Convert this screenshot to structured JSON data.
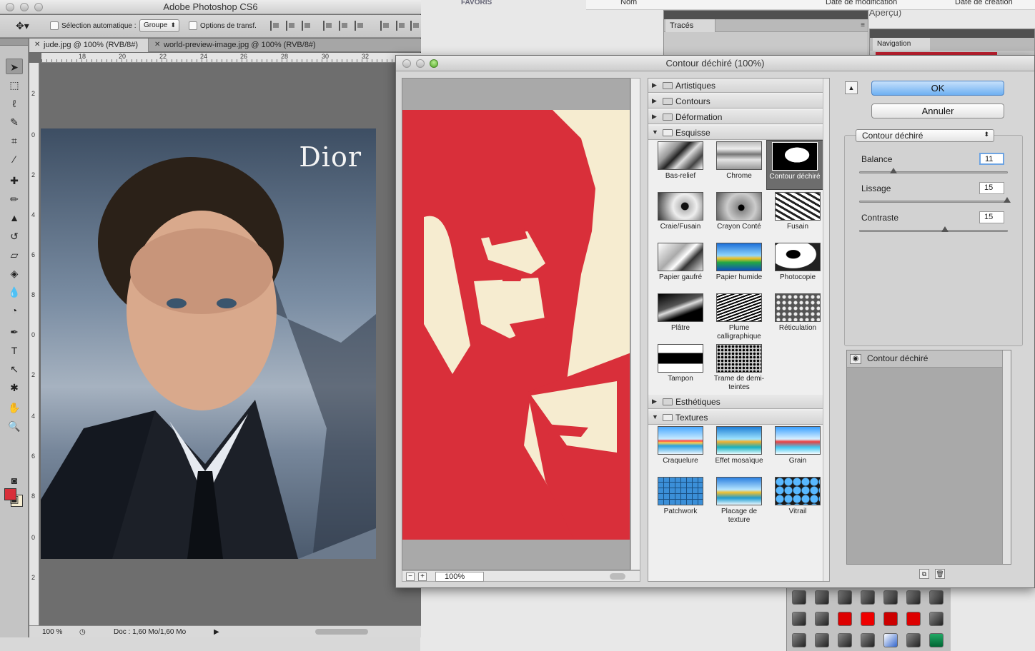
{
  "app": {
    "title": "Adobe Photoshop CS6"
  },
  "background": {
    "cmjn_text": "CMJN/Aperçu)",
    "favoris": "FAVORIS",
    "columns": [
      "Nom",
      "Date de modification",
      "Date de création"
    ],
    "traces_tab": "Tracés",
    "navigation_tab": "Navigation"
  },
  "options_bar": {
    "auto_select_label": "Sélection automatique :",
    "auto_select_value": "Groupe",
    "transform_label": "Options de transf."
  },
  "document_tabs": [
    {
      "label": "jude.jpg @ 100% (RVB/8#)",
      "active": true
    },
    {
      "label": "world-preview-image.jpg @ 100% (RVB/8#)",
      "active": false
    }
  ],
  "ruler_top": [
    "18",
    "20",
    "22",
    "24",
    "26",
    "28",
    "30",
    "32"
  ],
  "ruler_left": [
    "2",
    "0",
    "2",
    "4",
    "6",
    "8",
    "0",
    "2",
    "4",
    "6",
    "8",
    "0",
    "2"
  ],
  "photo": {
    "brand_text": "Dior"
  },
  "status_bar": {
    "zoom": "100 %",
    "doc_info": "Doc : 1,60 Mo/1,60 Mo"
  },
  "colors": {
    "foreground": "#d92f3a",
    "background": "#f5ecd0",
    "ok_blue": "#6eb0f2"
  },
  "dialog": {
    "title": "Contour déchiré (100%)",
    "zoom_value": "100%",
    "categories": [
      {
        "label": "Artistiques",
        "open": false
      },
      {
        "label": "Contours",
        "open": false
      },
      {
        "label": "Déformation",
        "open": false
      },
      {
        "label": "Esquisse",
        "open": true
      },
      {
        "label": "Esthétiques",
        "open": false
      },
      {
        "label": "Textures",
        "open": true
      }
    ],
    "esquisse_filters": [
      {
        "label": "Bas-relief",
        "icon": "bas-relief-thumb"
      },
      {
        "label": "Chrome",
        "icon": "chrome-thumb"
      },
      {
        "label": "Contour déchiré",
        "icon": "contour-dechire-thumb",
        "selected": true
      },
      {
        "label": "Craie/Fusain",
        "icon": "craie-fusain-thumb"
      },
      {
        "label": "Crayon Conté",
        "icon": "crayon-conte-thumb"
      },
      {
        "label": "Fusain",
        "icon": "fusain-thumb"
      },
      {
        "label": "Papier gaufré",
        "icon": "papier-gaufre-thumb"
      },
      {
        "label": "Papier humide",
        "icon": "papier-humide-thumb"
      },
      {
        "label": "Photocopie",
        "icon": "photocopie-thumb"
      },
      {
        "label": "Plâtre",
        "icon": "platre-thumb"
      },
      {
        "label": "Plume calligraphique",
        "icon": "plume-thumb"
      },
      {
        "label": "Réticulation",
        "icon": "reticulation-thumb"
      },
      {
        "label": "Tampon",
        "icon": "tampon-thumb"
      },
      {
        "label": "Trame de demi-teintes",
        "icon": "trame-thumb"
      }
    ],
    "texture_filters": [
      {
        "label": "Craquelure",
        "icon": "craquelure-thumb"
      },
      {
        "label": "Effet mosaïque",
        "icon": "mosaique-thumb"
      },
      {
        "label": "Grain",
        "icon": "grain-thumb"
      },
      {
        "label": "Patchwork",
        "icon": "patchwork-thumb"
      },
      {
        "label": "Placage de texture",
        "icon": "placage-thumb"
      },
      {
        "label": "Vitrail",
        "icon": "vitrail-thumb"
      }
    ],
    "ok_label": "OK",
    "cancel_label": "Annuler",
    "selected_filter": "Contour déchiré",
    "params": [
      {
        "label": "Balance",
        "value": "11",
        "fraction": 0.23
      },
      {
        "label": "Lissage",
        "value": "15",
        "fraction": 1.0
      },
      {
        "label": "Contraste",
        "value": "15",
        "fraction": 0.58
      }
    ],
    "layer_name": "Contour déchiré"
  }
}
